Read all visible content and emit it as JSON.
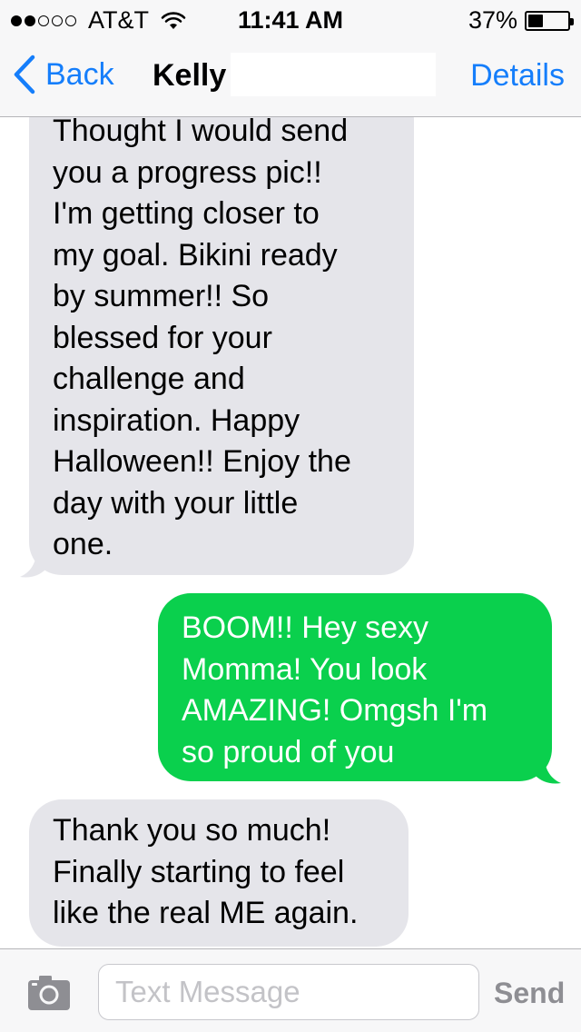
{
  "status_bar": {
    "carrier": "AT&T",
    "signal_bars_filled": 2,
    "signal_bars_total": 5,
    "time": "11:41 AM",
    "battery_percent": "37%",
    "battery_level": 0.37
  },
  "nav": {
    "back_label": "Back",
    "contact_name": "Kelly",
    "details_label": "Details"
  },
  "messages": [
    {
      "direction": "incoming",
      "text": "Thought I would send\nyou a progress pic!!\nI'm getting closer to\nmy goal. Bikini ready\nby summer!! So\nblessed for your\nchallenge and\ninspiration. Happy\nHalloween!! Enjoy the\nday with your little\none."
    },
    {
      "direction": "outgoing",
      "text": "BOOM!! Hey sexy\nMomma! You look\nAMAZING! Omgsh I'm\nso proud of you"
    },
    {
      "direction": "incoming",
      "text": "Thank you so much!\nFinally starting to feel\nlike the real ME again."
    }
  ],
  "composer": {
    "placeholder": "Text Message",
    "value": "",
    "send_label": "Send"
  },
  "colors": {
    "accent": "#157efb",
    "incoming_bubble": "#e5e5ea",
    "outgoing_bubble": "#0ad04d"
  },
  "icons": {
    "back": "chevron-left-icon",
    "camera": "camera-icon",
    "wifi": "wifi-icon",
    "battery": "battery-icon"
  }
}
